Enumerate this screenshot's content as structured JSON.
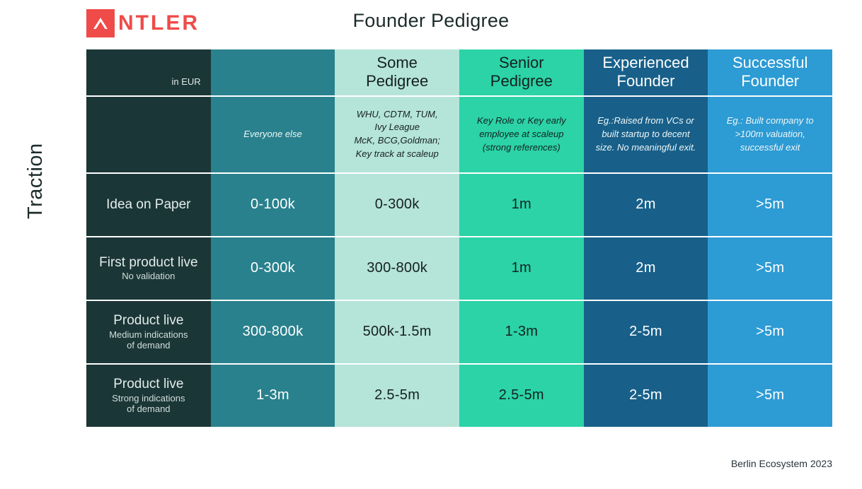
{
  "brand": {
    "logo_icon": "antler-peak-icon",
    "logo_word": "NTLER",
    "logo_color": "#ef4b49"
  },
  "header": {
    "title": "Founder Pedigree"
  },
  "axis": {
    "y_label": "Traction"
  },
  "footer": {
    "note": "Berlin Ecosystem 2023"
  },
  "matrix": {
    "corner_note": "in EUR",
    "columns": [
      {
        "label": "",
        "description": "",
        "color": "#1b3636"
      },
      {
        "label": "",
        "description": "Everyone else",
        "color": "#29818d"
      },
      {
        "label": "Some\nPedigree",
        "description": "WHU, CDTM, TUM,\nIvy League\nMcK, BCG,Goldman;\nKey track at scaleup",
        "color": "#b5e4d8"
      },
      {
        "label": "Senior\nPedigree",
        "description": "Key Role or Key early\nemployee at scaleup\n(strong references)",
        "color": "#2bd3a7"
      },
      {
        "label": "Experienced\nFounder",
        "description": "Eg.:Raised from VCs or\nbuilt startup to decent\nsize. No meaningful exit.",
        "color": "#18608a"
      },
      {
        "label": "Successful\nFounder",
        "description": "Eg.: Built company to\n>100m valuation,\nsuccessful exit",
        "color": "#2d9bd4"
      }
    ],
    "column_labels": {
      "col3": "Some\nPedigree",
      "col4": "Senior\nPedigree",
      "col5": "Experienced\nFounder",
      "col6": "Successful\nFounder"
    },
    "descriptions": {
      "col2": "Everyone else",
      "col3": "WHU, CDTM, TUM,\nIvy League\nMcK, BCG,Goldman;\nKey track at scaleup",
      "col4": "Key Role or Key early\nemployee at scaleup\n(strong references)",
      "col5": "Eg.:Raised from VCs or\nbuilt startup to decent\nsize. No meaningful exit.",
      "col6": "Eg.: Built company to\n>100m valuation,\nsuccessful exit"
    },
    "rows": [
      {
        "label_main": "Idea on Paper",
        "label_sub": "",
        "values": [
          "0-100k",
          "0-300k",
          "1m",
          "2m",
          ">5m"
        ]
      },
      {
        "label_main": "First product live",
        "label_sub": "No validation",
        "values": [
          "0-300k",
          "300-800k",
          "1m",
          "2m",
          ">5m"
        ]
      },
      {
        "label_main": "Product live",
        "label_sub": "Medium indications\nof demand",
        "values": [
          "300-800k",
          "500k-1.5m",
          "1-3m",
          "2-5m",
          ">5m"
        ]
      },
      {
        "label_main": "Product live",
        "label_sub": "Strong indications\nof demand",
        "values": [
          "1-3m",
          "2.5-5m",
          "2.5-5m",
          "2-5m",
          ">5m"
        ]
      }
    ]
  }
}
